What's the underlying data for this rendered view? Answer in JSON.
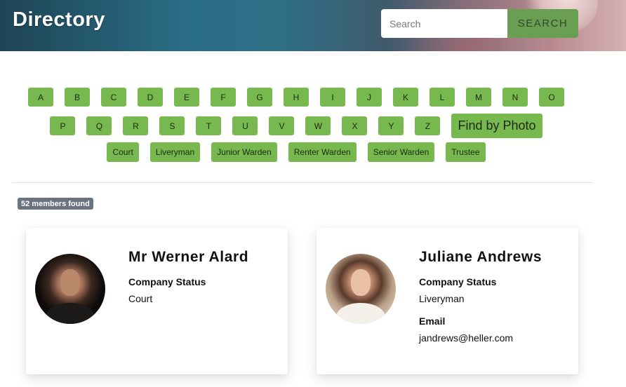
{
  "header": {
    "title": "Directory",
    "search_placeholder": "Search",
    "search_button": "SEARCH"
  },
  "filters": {
    "letters_row1": [
      "A",
      "B",
      "C",
      "D",
      "E",
      "F",
      "G",
      "H",
      "I",
      "J",
      "K",
      "L",
      "M",
      "N",
      "O"
    ],
    "letters_row2": [
      "P",
      "Q",
      "R",
      "S",
      "T",
      "U",
      "V",
      "W",
      "X",
      "Y",
      "Z"
    ],
    "find_by_photo": "Find by Photo",
    "roles": [
      "Court",
      "Liveryman",
      "Junior Warden",
      "Renter Warden",
      "Senior Warden",
      "Trustee"
    ]
  },
  "results": {
    "count_text": "52 members found"
  },
  "members": [
    {
      "name": "Mr Werner Alard",
      "status_label": "Company Status",
      "status": "Court"
    },
    {
      "name": "Juliane Andrews",
      "status_label": "Company Status",
      "status": "Liveryman",
      "email_label": "Email",
      "email": "jandrews@heller.com"
    }
  ],
  "colors": {
    "accent_green": "#77b84f",
    "search_button": "#6a9f53",
    "badge_gray": "#6b7280"
  }
}
